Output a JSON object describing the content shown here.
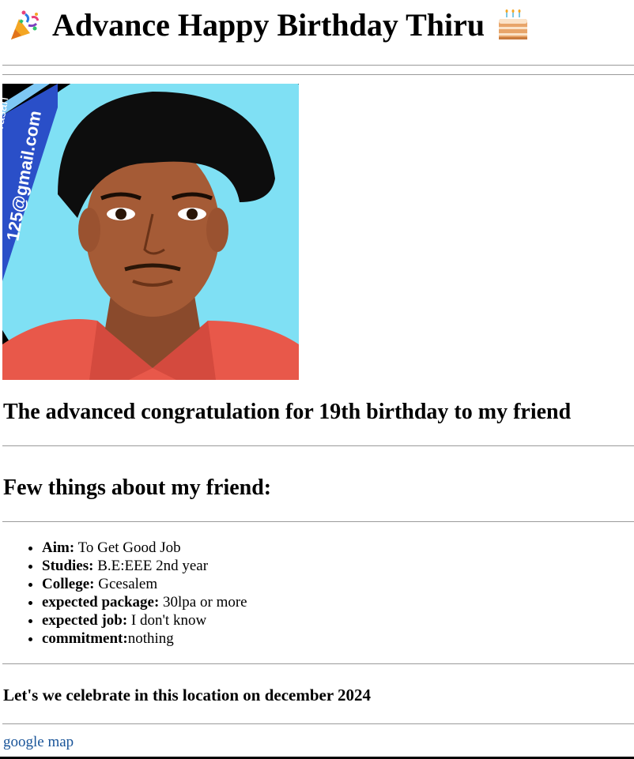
{
  "header": {
    "title": "Advance Happy Birthday Thiru",
    "left_emoji_icon": "party-popper-icon",
    "right_emoji_icon": "birthday-cake-icon"
  },
  "photo": {
    "alt": "",
    "watermark_text": "125@gmail.com",
    "watermark_text_2": "vasan"
  },
  "congrats": {
    "text": "The advanced congratulation for 19th birthday to my friend"
  },
  "about": {
    "heading": "Few things about my friend:",
    "items": [
      {
        "label": "Aim:",
        "value": " To Get Good Job"
      },
      {
        "label": "Studies:",
        "value": " B.E:EEE 2nd year"
      },
      {
        "label": "College:",
        "value": " Gcesalem"
      },
      {
        "label": "expected package:",
        "value": " 30lpa or more"
      },
      {
        "label": "expected job:",
        "value": " I don't know"
      },
      {
        "label": "commitment:",
        "value": "nothing"
      }
    ]
  },
  "celebrate": {
    "text": "Let's we celebrate in this location on december 2024"
  },
  "map_link": {
    "text": "google map"
  },
  "colors": {
    "link": "#1a5599",
    "rule": "#9a9a9a",
    "photo_background": "#7fe0f4"
  }
}
